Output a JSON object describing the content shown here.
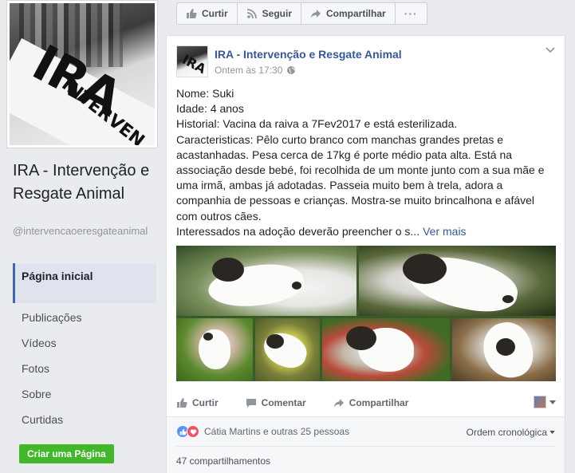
{
  "page": {
    "name": "IRA - Intervenção e Resgate Animal",
    "handle": "@intervencaoeresgateanimal",
    "cover_text": "IRA",
    "cover_subtext": "INTERVEN"
  },
  "sidebar": {
    "items": [
      {
        "label": "Página inicial",
        "active": true
      },
      {
        "label": "Publicações"
      },
      {
        "label": "Vídeos"
      },
      {
        "label": "Fotos"
      },
      {
        "label": "Sobre"
      },
      {
        "label": "Curtidas"
      }
    ],
    "create_page_label": "Criar uma Página"
  },
  "actionbar": {
    "like_label": "Curtir",
    "follow_label": "Seguir",
    "share_label": "Compartilhar",
    "more_label": "···"
  },
  "post": {
    "author": "IRA - Intervenção e Resgate Animal",
    "timestamp": "Ontem às 17:30",
    "lines": [
      "Nome: Suki",
      "Idade: 4 anos",
      "Historial: Vacina da raiva a 7Fev2017 e está esterilizada.",
      "Caracteristicas: Pêlo curto branco com manchas grandes pretas e",
      "acastanhadas. Pesa cerca de 17kg é porte médio pata alta. Está na",
      "associação desde bebé, foi recolhida de um monte junto com a sua mãe e",
      "uma irmã, ambas já adotadas. Passeia muito bem à trela, adora a",
      "companhia de pessoas e crianças. Mostra-se muito brincalhona e afável",
      "com outros cães."
    ],
    "last_line": "Interessados na adoção deverão preencher o s...",
    "see_more": "Ver mais",
    "actions": {
      "like": "Curtir",
      "comment": "Comentar",
      "share": "Compartilhar"
    },
    "reactions_text": "Cátia Martins e outras 25 pessoas",
    "sort_label": "Ordem cronológica",
    "shares_text": "47 compartilhamentos"
  },
  "colors": {
    "link": "#365899",
    "green_button": "#42b72a",
    "like_blue": "#5890ff",
    "love_red": "#f25268",
    "active_nav_border": "#4267b2"
  }
}
